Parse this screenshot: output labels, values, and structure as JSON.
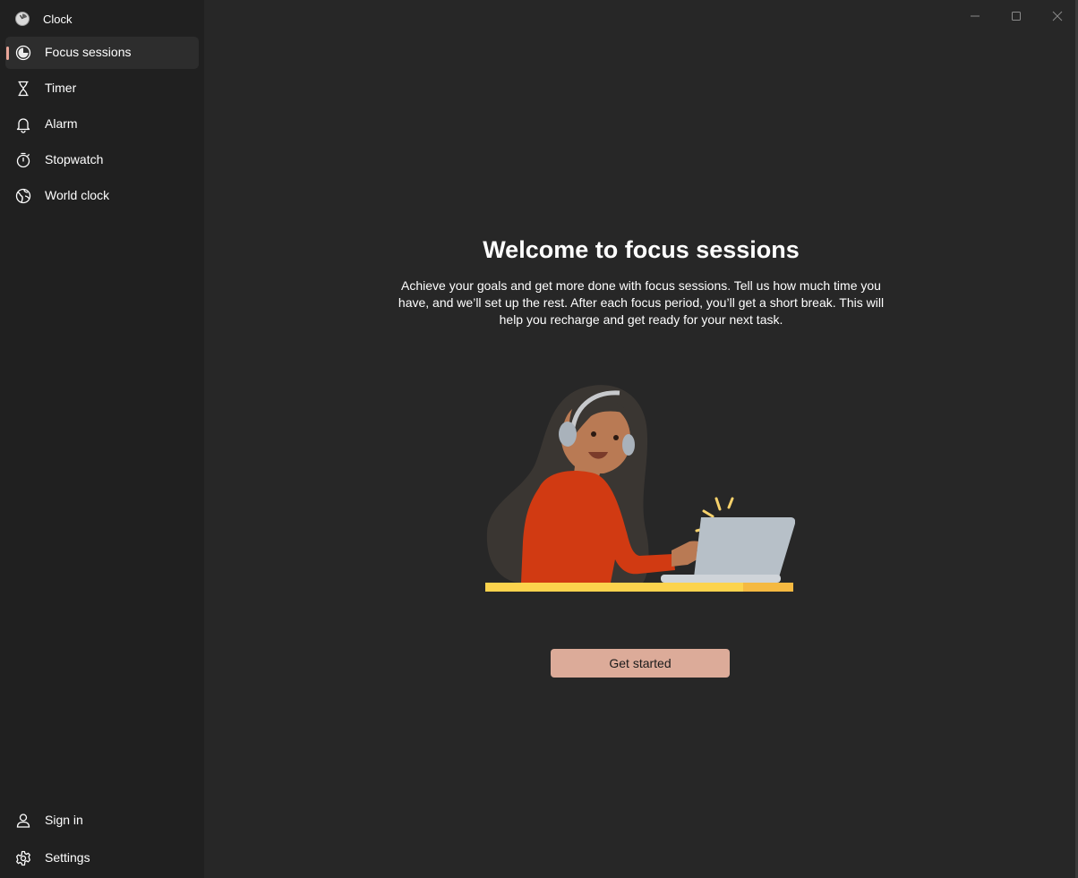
{
  "app": {
    "title": "Clock"
  },
  "sidebar": {
    "items": [
      {
        "label": "Focus sessions",
        "icon": "focus-icon",
        "selected": true
      },
      {
        "label": "Timer",
        "icon": "hourglass-icon"
      },
      {
        "label": "Alarm",
        "icon": "bell-icon"
      },
      {
        "label": "Stopwatch",
        "icon": "stopwatch-icon"
      },
      {
        "label": "World clock",
        "icon": "globe-icon"
      }
    ],
    "footer": [
      {
        "label": "Sign in",
        "icon": "person-icon"
      },
      {
        "label": "Settings",
        "icon": "gear-icon"
      }
    ]
  },
  "main": {
    "title": "Welcome to focus sessions",
    "description": "Achieve your goals and get more done with focus sessions. Tell us how much time you have, and we’ll set up the rest. After each focus period, you’ll get a short break. This will help you recharge and get ready for your next task.",
    "cta_label": "Get started"
  },
  "colors": {
    "accent": "#e8a598",
    "button": "#dcab99",
    "sidebar_bg": "#202020",
    "content_bg": "#272727"
  }
}
